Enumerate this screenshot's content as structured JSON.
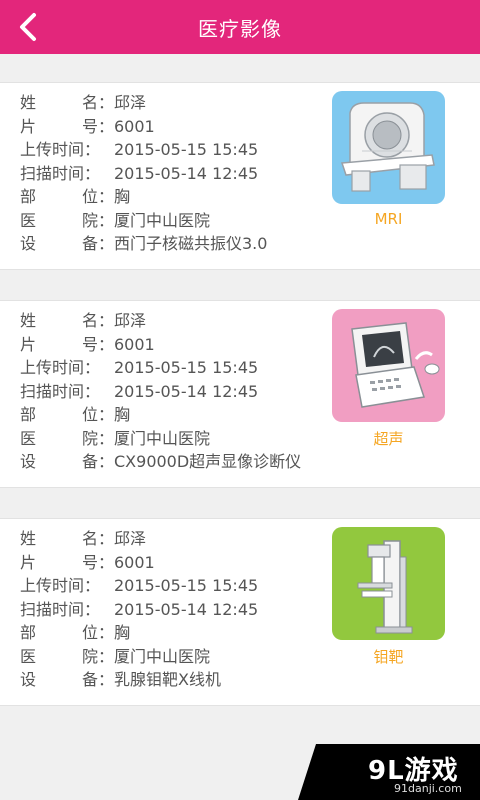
{
  "header": {
    "title": "医疗影像"
  },
  "labels": {
    "name": [
      "姓",
      "名："
    ],
    "film_no": [
      "片",
      "号："
    ],
    "upload_time": "上传时间：",
    "scan_time": "扫描时间：",
    "part": [
      "部",
      "位："
    ],
    "hospital": [
      "医",
      "院："
    ],
    "device": [
      "设",
      "备："
    ]
  },
  "records": [
    {
      "name": "邱泽",
      "film_no": "6001",
      "upload_time": "2015-05-15 15:45",
      "scan_time": "2015-05-14 12:45",
      "part": "胸",
      "hospital": "厦门中山医院",
      "device": "西门子核磁共振仪3.0",
      "type_label": "MRI",
      "thumb_bg": "#7ec8ef"
    },
    {
      "name": "邱泽",
      "film_no": "6001",
      "upload_time": "2015-05-15 15:45",
      "scan_time": "2015-05-14 12:45",
      "part": "胸",
      "hospital": "厦门中山医院",
      "device": "CX9000D超声显像诊断仪",
      "type_label": "超声",
      "thumb_bg": "#f19ec2"
    },
    {
      "name": "邱泽",
      "film_no": "6001",
      "upload_time": "2015-05-15 15:45",
      "scan_time": "2015-05-14 12:45",
      "part": "胸",
      "hospital": "厦门中山医院",
      "device": "乳腺钼靶X线机",
      "type_label": "钼靶",
      "thumb_bg": "#92c83e"
    }
  ],
  "watermark": {
    "main": "9L游戏",
    "sub": "91danji.com"
  },
  "colors": {
    "header": "#e3267b",
    "accent_label": "#f5a623"
  }
}
